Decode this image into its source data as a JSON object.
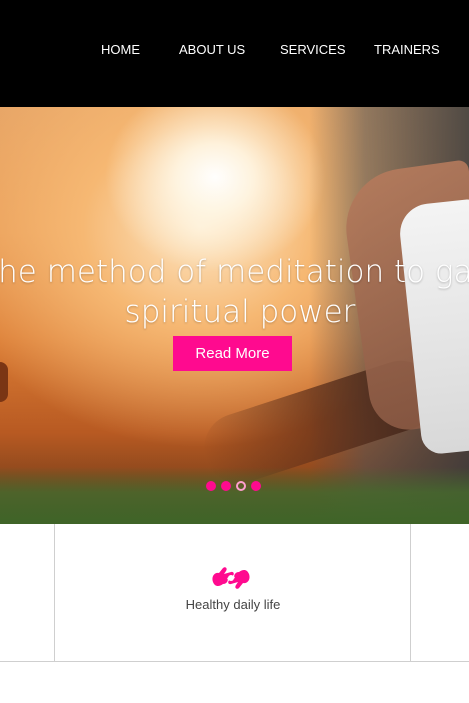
{
  "nav": {
    "items": [
      {
        "label": "HOME"
      },
      {
        "label": "ABOUT US"
      },
      {
        "label": "SERVICES"
      },
      {
        "label": "TRAINERS"
      }
    ]
  },
  "hero": {
    "caption": "The method of meditation to gain spiritual power",
    "button_label": "Read More",
    "slides": 4,
    "active_slide": 3
  },
  "features": {
    "items": [
      {
        "label": "Healthy daily life",
        "icon": "hands-icon"
      }
    ]
  },
  "colors": {
    "accent": "#ff0a8f",
    "navbar_bg": "#000000",
    "border": "#cfcfcf",
    "text": "#444444"
  }
}
